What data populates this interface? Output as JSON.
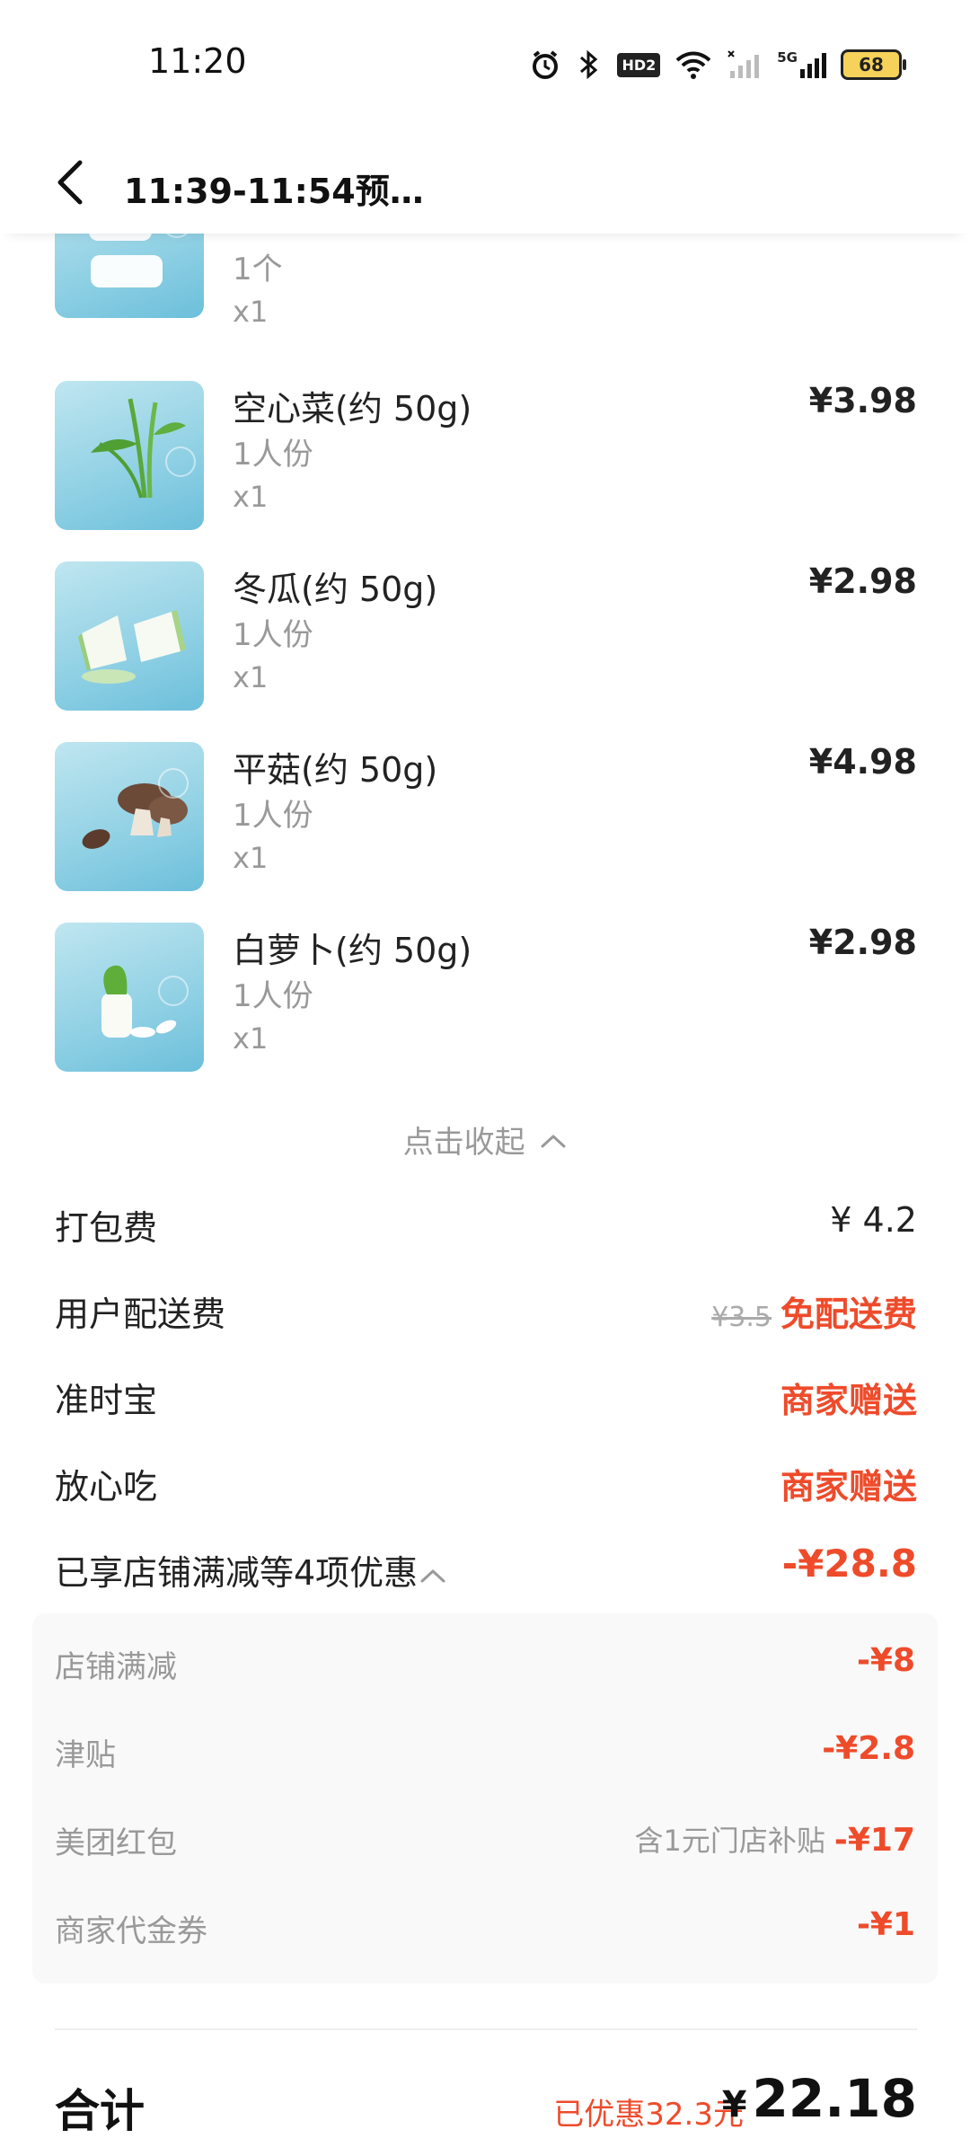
{
  "status_bar": {
    "time": "11:20",
    "icons": [
      "alarm-icon",
      "bluetooth-icon",
      "hd-icon",
      "wifi-icon",
      "signal-icon",
      "5g-signal-icon",
      "battery-icon"
    ],
    "hd_label": "HD2",
    "network_label": "5G",
    "battery_level": "68"
  },
  "header": {
    "title": "11:39-11:54预…"
  },
  "items": [
    {
      "name": "",
      "spec": "1个",
      "qty": "x1",
      "price": ""
    },
    {
      "name": "空心菜(约 50g)",
      "spec": "1人份",
      "qty": "x1",
      "price": "¥3.98"
    },
    {
      "name": "冬瓜(约 50g)",
      "spec": "1人份",
      "qty": "x1",
      "price": "¥2.98"
    },
    {
      "name": "平菇(约 50g)",
      "spec": "1人份",
      "qty": "x1",
      "price": "¥4.98"
    },
    {
      "name": "白萝卜(约 50g)",
      "spec": "1人份",
      "qty": "x1",
      "price": "¥2.98"
    }
  ],
  "collapse_label": "点击收起",
  "fees": {
    "packing": {
      "label": "打包费",
      "value": "¥ 4.2"
    },
    "delivery": {
      "label": "用户配送费",
      "original": "¥3.5",
      "value": "免配送费"
    },
    "ontime": {
      "label": "准时宝",
      "value": "商家赠送"
    },
    "safe": {
      "label": "放心吃",
      "value": "商家赠送"
    },
    "discount_summary": {
      "label": "已享店铺满减等4项优惠",
      "value": "-¥28.8"
    }
  },
  "discounts": [
    {
      "label": "店铺满减",
      "note": "",
      "value": "-¥8"
    },
    {
      "label": "津贴",
      "note": "",
      "value": "-¥2.8"
    },
    {
      "label": "美团红包",
      "note": "含1元门店补贴",
      "value": "-¥17"
    },
    {
      "label": "商家代金券",
      "note": "",
      "value": "-¥1"
    }
  ],
  "total": {
    "label": "合计",
    "saved": "已优惠32.3元",
    "currency": "¥",
    "amount": "22.18"
  },
  "colors": {
    "accent_red": "#ee4b2b",
    "muted_text": "#999999",
    "thumb_bg": "#8fd0e4"
  }
}
